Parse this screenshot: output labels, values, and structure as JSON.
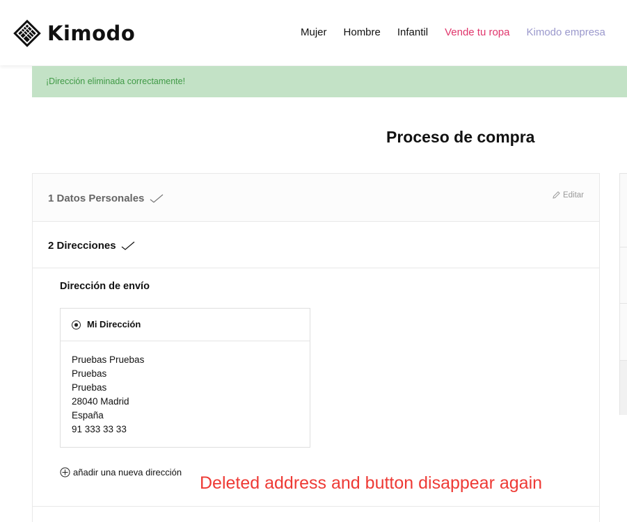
{
  "header": {
    "logo_text": "Kimodo",
    "nav": [
      {
        "label": "Mujer"
      },
      {
        "label": "Hombre"
      },
      {
        "label": "Infantil"
      },
      {
        "label": "Vende tu ropa",
        "color": "#e0356b"
      },
      {
        "label": "Kimodo empresa",
        "color": "#9a98cc"
      }
    ]
  },
  "alert": {
    "message": "¡Dirección eliminada correctamente!",
    "background": "#c3e2c6",
    "text_color": "#3f9945"
  },
  "page_title": "Proceso de compra",
  "checkout": {
    "step1": {
      "title": "1 Datos Personales",
      "edit_label": "Editar",
      "completed": true
    },
    "step2": {
      "title": "2 Direcciones",
      "completed": true
    },
    "shipping": {
      "title": "Dirección de envío",
      "address": {
        "name": "Mi Dirección",
        "selected": true,
        "lines": [
          "Pruebas Pruebas",
          "Pruebas",
          "Pruebas",
          "28040 Madrid",
          "España",
          "91 333 33 33"
        ]
      },
      "add_new_label": "añadir una nueva dirección"
    }
  },
  "annotation": {
    "text": "Deleted address and button disappear again",
    "color": "#ee3a35"
  }
}
